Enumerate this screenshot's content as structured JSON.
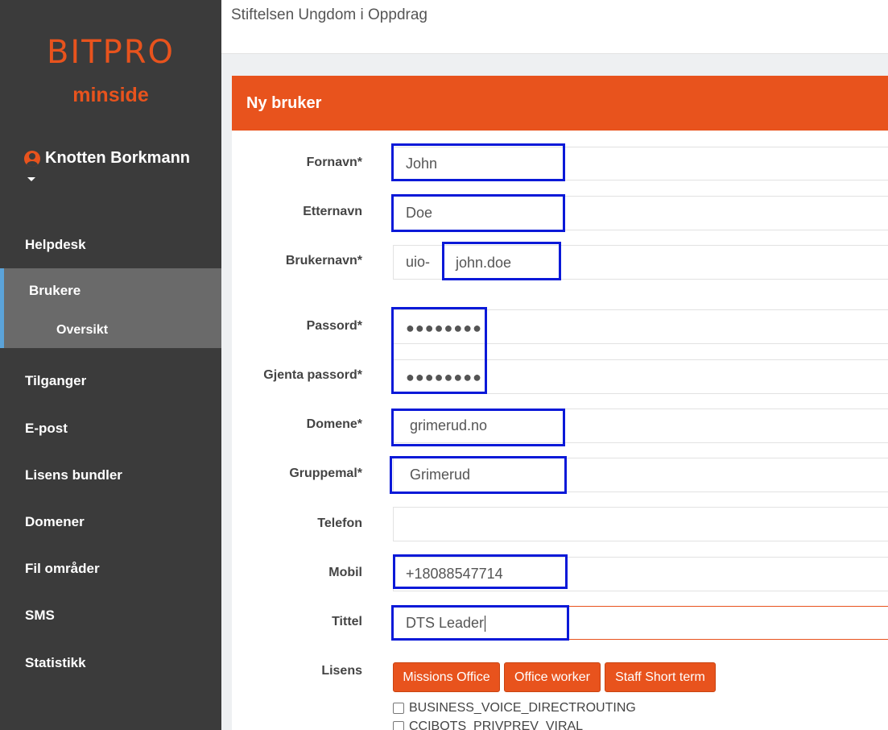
{
  "sidebar": {
    "logo": "BITPRO",
    "subtitle": "minside",
    "user_name": "Knotten Borkmann",
    "items": [
      {
        "label": "Helpdesk"
      },
      {
        "label": "Brukere"
      },
      {
        "label": "Oversikt"
      },
      {
        "label": "Tilganger"
      },
      {
        "label": "E-post"
      },
      {
        "label": "Lisens bundler"
      },
      {
        "label": "Domener"
      },
      {
        "label": "Fil områder"
      },
      {
        "label": "SMS"
      },
      {
        "label": "Statistikk"
      }
    ]
  },
  "header": {
    "title": "Stiftelsen Ungdom i Oppdrag"
  },
  "panel": {
    "title": "Ny bruker"
  },
  "form": {
    "fornavn": {
      "label": "Fornavn*",
      "value": "John"
    },
    "etternavn": {
      "label": "Etternavn",
      "value": "Doe"
    },
    "brukernavn": {
      "label": "Brukernavn*",
      "prefix": "uio-",
      "value": "john.doe"
    },
    "passord": {
      "label": "Passord*",
      "value": "●●●●●●●●"
    },
    "gjenta": {
      "label": "Gjenta passord*",
      "value": "●●●●●●●●"
    },
    "domene": {
      "label": "Domene*",
      "value": "grimerud.no"
    },
    "gruppemal": {
      "label": "Gruppemal*",
      "value": "Grimerud"
    },
    "telefon": {
      "label": "Telefon",
      "value": ""
    },
    "mobil": {
      "label": "Mobil",
      "value": "+18088547714"
    },
    "tittel": {
      "label": "Tittel",
      "value": "DTS Leader"
    },
    "lisens": {
      "label": "Lisens",
      "buttons": [
        "Missions Office",
        "Office worker",
        "Staff Short term"
      ],
      "checkboxes": [
        "BUSINESS_VOICE_DIRECTROUTING",
        "CCIBOTS_PRIVPREV_VIRAL"
      ]
    }
  },
  "colors": {
    "accent": "#e8531d",
    "sidebar_bg": "#3b3b3b",
    "highlight": "#0a19d8",
    "active_bar": "#5ba3d9"
  }
}
